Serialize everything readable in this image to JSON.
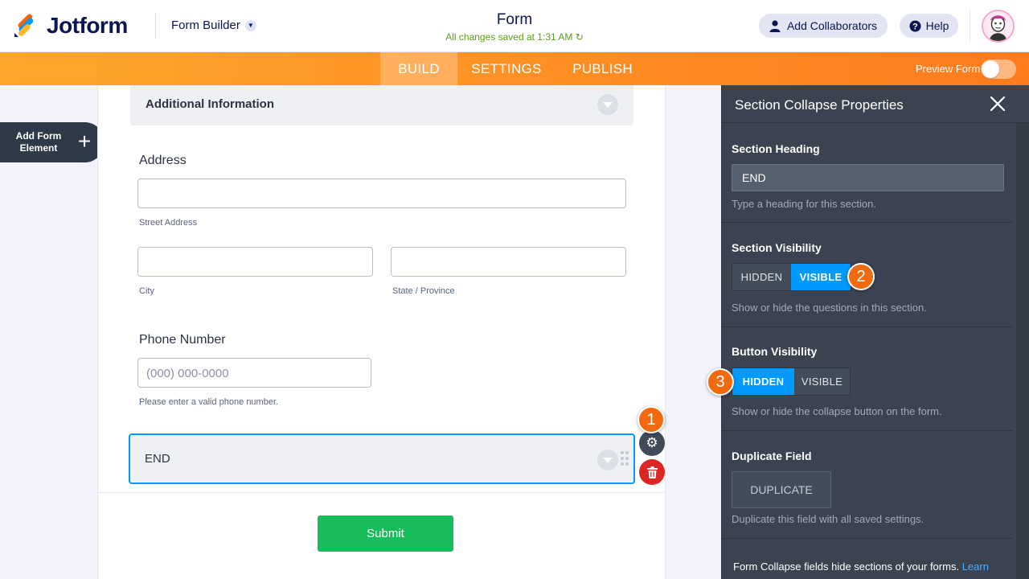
{
  "header": {
    "brand": "Jotform",
    "builder_menu": "Form Builder",
    "form_title": "Form",
    "save_status": "All changes saved at 1:31 AM",
    "add_collaborators": "Add Collaborators",
    "help": "Help"
  },
  "nav": {
    "tabs": [
      "BUILD",
      "SETTINGS",
      "PUBLISH"
    ],
    "active_tab": "BUILD",
    "preview_label": "Preview Form",
    "preview_on": false
  },
  "sidebar_left": {
    "add_element_label": "Add Form Element",
    "add_icon": "+"
  },
  "form": {
    "section_top": "Additional Information",
    "address": {
      "label": "Address",
      "street_sub": "Street Address",
      "city_sub": "City",
      "state_sub": "State / Province"
    },
    "phone": {
      "label": "Phone Number",
      "placeholder": "(000) 000-0000",
      "sub": "Please enter a valid phone number."
    },
    "end_section": "END",
    "submit": "Submit"
  },
  "badges": [
    "1",
    "2",
    "3"
  ],
  "panel": {
    "title": "Section Collapse Properties",
    "heading": {
      "title": "Section Heading",
      "value": "END",
      "help": "Type a heading for this section."
    },
    "section_visibility": {
      "title": "Section Visibility",
      "options": [
        "HIDDEN",
        "VISIBLE"
      ],
      "selected": "VISIBLE",
      "help": "Show or hide the questions in this section."
    },
    "button_visibility": {
      "title": "Button Visibility",
      "options": [
        "HIDDEN",
        "VISIBLE"
      ],
      "selected": "HIDDEN",
      "help": "Show or hide the collapse button on the form."
    },
    "duplicate": {
      "title": "Duplicate Field",
      "button": "DUPLICATE",
      "help": "Duplicate this field with all saved settings."
    },
    "note": "Form Collapse fields hide sections of your forms.",
    "note_link": "Learn"
  },
  "colors": {
    "accent_blue": "#0099ff",
    "brand_orange": "#ff7b1c",
    "submit_green": "#18bd5b",
    "delete_red": "#dc2626",
    "panel_bg": "#3b4350"
  }
}
